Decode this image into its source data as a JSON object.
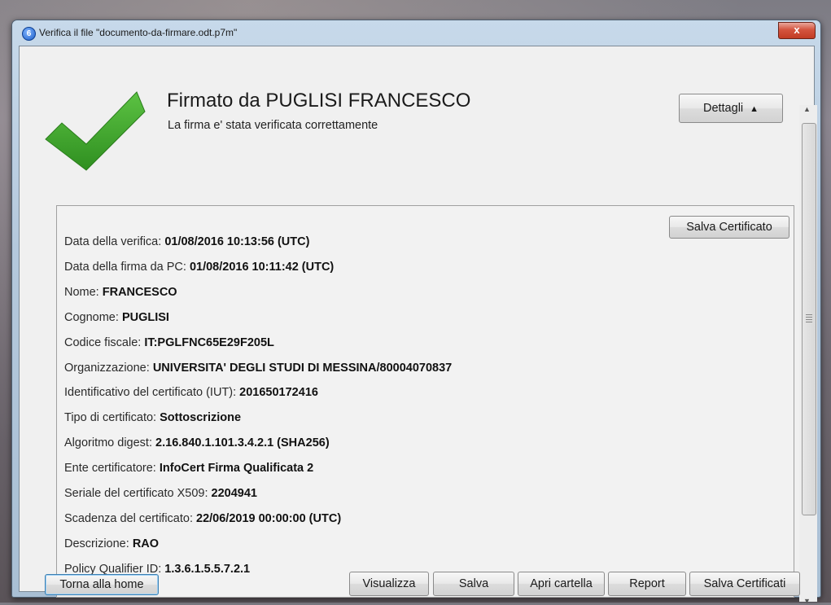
{
  "window": {
    "title": "Verifica il file \"documento-da-firmare.odt.p7m\"",
    "close_symbol": "x"
  },
  "status": {
    "icon": "check-icon",
    "color": "#3aa129",
    "title": "Firmato da PUGLISI FRANCESCO",
    "subtitle": "La firma e' stata verificata correttamente"
  },
  "details_button": {
    "label": "Dettagli",
    "arrow": "▲"
  },
  "info": {
    "save_certificate_label": "Salva Certificato",
    "rows": [
      {
        "key": "Data della verifica: ",
        "value": "01/08/2016 10:13:56 (UTC)"
      },
      {
        "key": "Data della firma da PC: ",
        "value": "01/08/2016 10:11:42 (UTC)"
      },
      {
        "key": "Nome: ",
        "value": "FRANCESCO"
      },
      {
        "key": "Cognome: ",
        "value": "PUGLISI"
      },
      {
        "key": "Codice fiscale: ",
        "value": "IT:PGLFNC65E29F205L"
      },
      {
        "key": "Organizzazione: ",
        "value": "UNIVERSITA' DEGLI STUDI DI MESSINA/80004070837"
      },
      {
        "key": "Identificativo del certificato (IUT): ",
        "value": "201650172416"
      },
      {
        "key": "Tipo di certificato: ",
        "value": "Sottoscrizione"
      },
      {
        "key": "Algoritmo digest: ",
        "value": "2.16.840.1.101.3.4.2.1 (SHA256)"
      },
      {
        "key": "Ente certificatore: ",
        "value": "InfoCert Firma Qualificata 2"
      },
      {
        "key": "Seriale del certificato X509: ",
        "value": "2204941"
      },
      {
        "key": "Scadenza del certificato: ",
        "value": "22/06/2019 00:00:00 (UTC)"
      },
      {
        "key": "Descrizione: ",
        "value": "RAO"
      },
      {
        "key": "Policy Qualifier ID: ",
        "value": "1.3.6.1.5.5.7.2.1"
      }
    ]
  },
  "footer": {
    "home": "Torna alla home",
    "view": "Visualizza",
    "save": "Salva",
    "open_folder": "Apri cartella",
    "report": "Report",
    "save_certificates": "Salva Certificati"
  }
}
